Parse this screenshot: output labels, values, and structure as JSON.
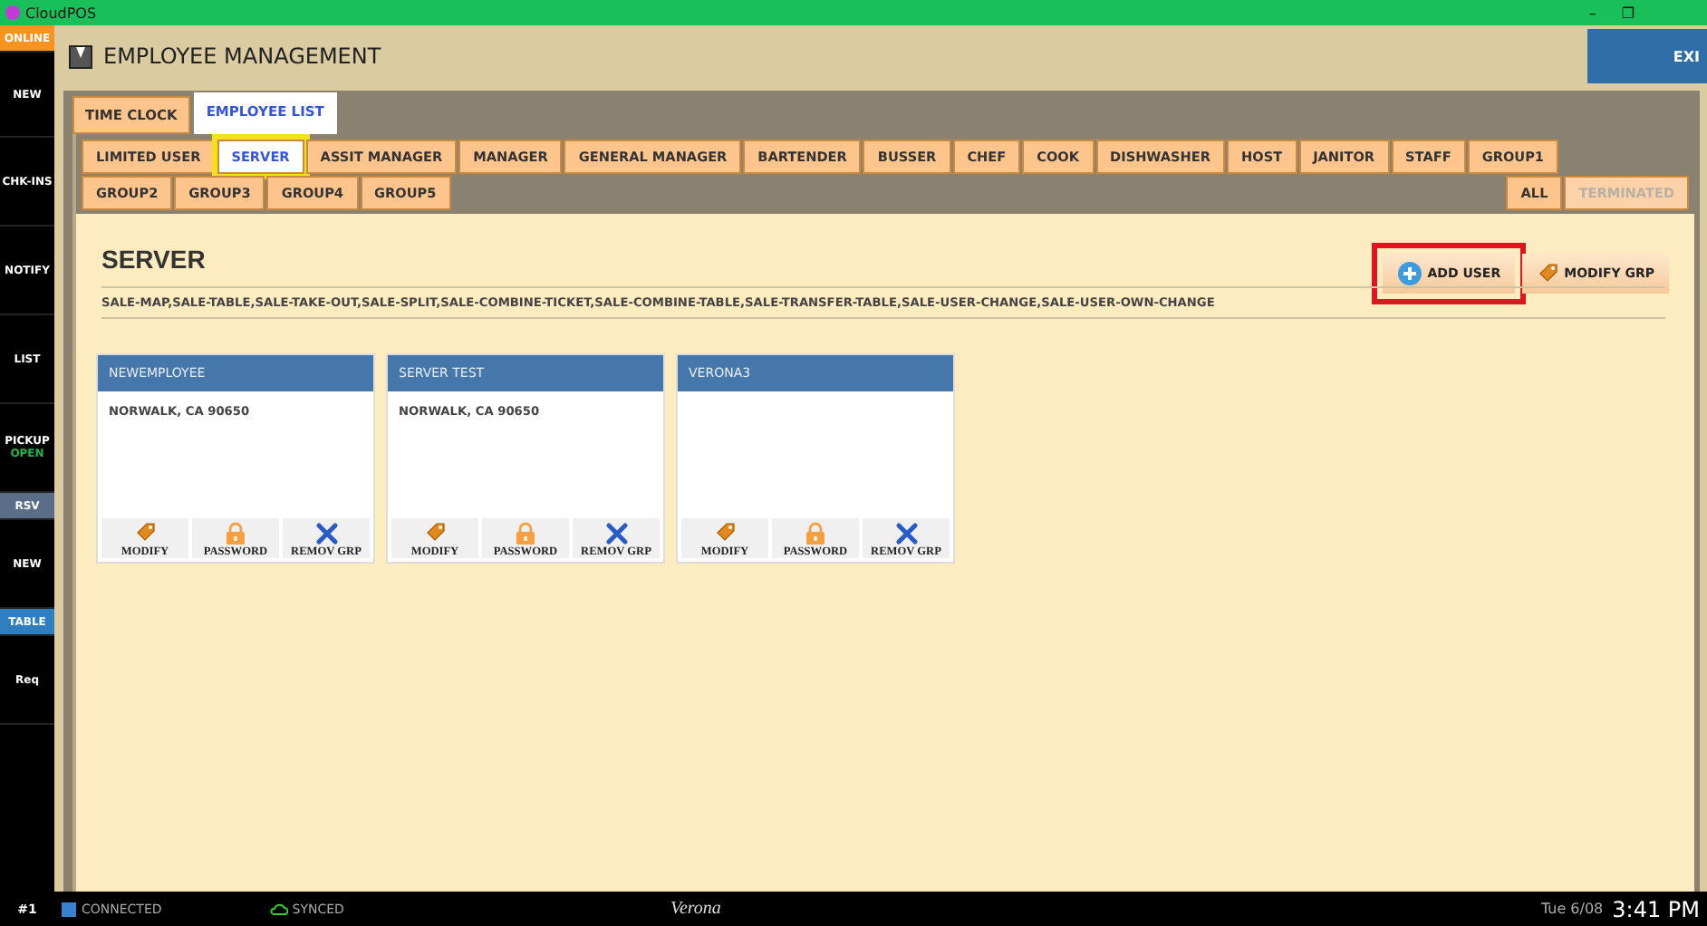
{
  "window": {
    "title": "CloudPOS",
    "controls": [
      "–",
      "❐"
    ]
  },
  "sidebar": {
    "items": [
      {
        "label": "ONLINE",
        "kind": "status"
      },
      {
        "label": "NEW",
        "kind": "plain"
      },
      {
        "label": "CHK-INS",
        "kind": "plain"
      },
      {
        "label": "NOTIFY",
        "kind": "plain"
      },
      {
        "label": "LIST",
        "kind": "plain"
      },
      {
        "label": "PICKUP",
        "sub": "OPEN",
        "kind": "plain"
      },
      {
        "label": "RSV",
        "kind": "muted"
      },
      {
        "label": "NEW",
        "kind": "plain"
      },
      {
        "label": "TABLE",
        "kind": "active"
      },
      {
        "label": "Req",
        "kind": "plain"
      }
    ]
  },
  "header": {
    "title": "EMPLOYEE MANAGEMENT",
    "exit_button": "EXI"
  },
  "tabs": [
    {
      "label": "TIME CLOCK",
      "selected": false
    },
    {
      "label": "EMPLOYEE LIST",
      "selected": true
    }
  ],
  "role_tabs": [
    {
      "label": "LIMITED USER",
      "selected": false,
      "highlighted": false
    },
    {
      "label": "SERVER",
      "selected": true,
      "highlighted": true
    },
    {
      "label": "ASSIT MANAGER",
      "selected": false,
      "highlighted": false
    },
    {
      "label": "MANAGER",
      "selected": false,
      "highlighted": false
    },
    {
      "label": "GENERAL MANAGER",
      "selected": false,
      "highlighted": false
    },
    {
      "label": "BARTENDER",
      "selected": false,
      "highlighted": false
    },
    {
      "label": "BUSSER",
      "selected": false,
      "highlighted": false
    },
    {
      "label": "CHEF",
      "selected": false,
      "highlighted": false
    },
    {
      "label": "COOK",
      "selected": false,
      "highlighted": false
    },
    {
      "label": "DISHWASHER",
      "selected": false,
      "highlighted": false
    },
    {
      "label": "HOST",
      "selected": false,
      "highlighted": false
    },
    {
      "label": "JANITOR",
      "selected": false,
      "highlighted": false
    },
    {
      "label": "STAFF",
      "selected": false,
      "highlighted": false
    },
    {
      "label": "GROUP1",
      "selected": false,
      "highlighted": false
    },
    {
      "label": "GROUP2",
      "selected": false,
      "highlighted": false
    },
    {
      "label": "GROUP3",
      "selected": false,
      "highlighted": false
    },
    {
      "label": "GROUP4",
      "selected": false,
      "highlighted": false
    },
    {
      "label": "GROUP5",
      "selected": false,
      "highlighted": false
    }
  ],
  "filters": [
    {
      "label": "ALL",
      "disabled": false
    },
    {
      "label": "TERMINATED",
      "disabled": true
    }
  ],
  "group": {
    "title": "SERVER",
    "permissions": "SALE-MAP,SALE-TABLE,SALE-TAKE-OUT,SALE-SPLIT,SALE-COMBINE-TICKET,SALE-COMBINE-TABLE,SALE-TRANSFER-TABLE,SALE-USER-CHANGE,SALE-USER-OWN-CHANGE",
    "actions": [
      {
        "label": "ADD USER",
        "kind": "add",
        "highlighted": true
      },
      {
        "label": "MODIFY GRP",
        "kind": "modify",
        "highlighted": false
      }
    ]
  },
  "employees": [
    {
      "name": "NEWEMPLOYEE",
      "address": "NORWALK, CA 90650",
      "actions": [
        {
          "label": "MODIFY",
          "kind": "modify"
        },
        {
          "label": "PASSWORD",
          "kind": "password"
        },
        {
          "label": "REMOV GRP",
          "kind": "remove"
        }
      ]
    },
    {
      "name": "SERVER TEST",
      "address": "NORWALK, CA 90650",
      "actions": [
        {
          "label": "MODIFY",
          "kind": "modify"
        },
        {
          "label": "PASSWORD",
          "kind": "password"
        },
        {
          "label": "REMOV GRP",
          "kind": "remove"
        }
      ]
    },
    {
      "name": "VERONA3",
      "actions": [
        {
          "label": "MODIFY",
          "kind": "modify"
        },
        {
          "label": "PASSWORD",
          "kind": "password"
        },
        {
          "label": "REMOV GRP",
          "kind": "remove"
        }
      ]
    }
  ],
  "status_bar": {
    "station": "#1",
    "connection": "CONNECTED",
    "sync": "SYNCED",
    "store": "Verona",
    "date": "Tue 6/08",
    "time": "3:41 PM"
  }
}
